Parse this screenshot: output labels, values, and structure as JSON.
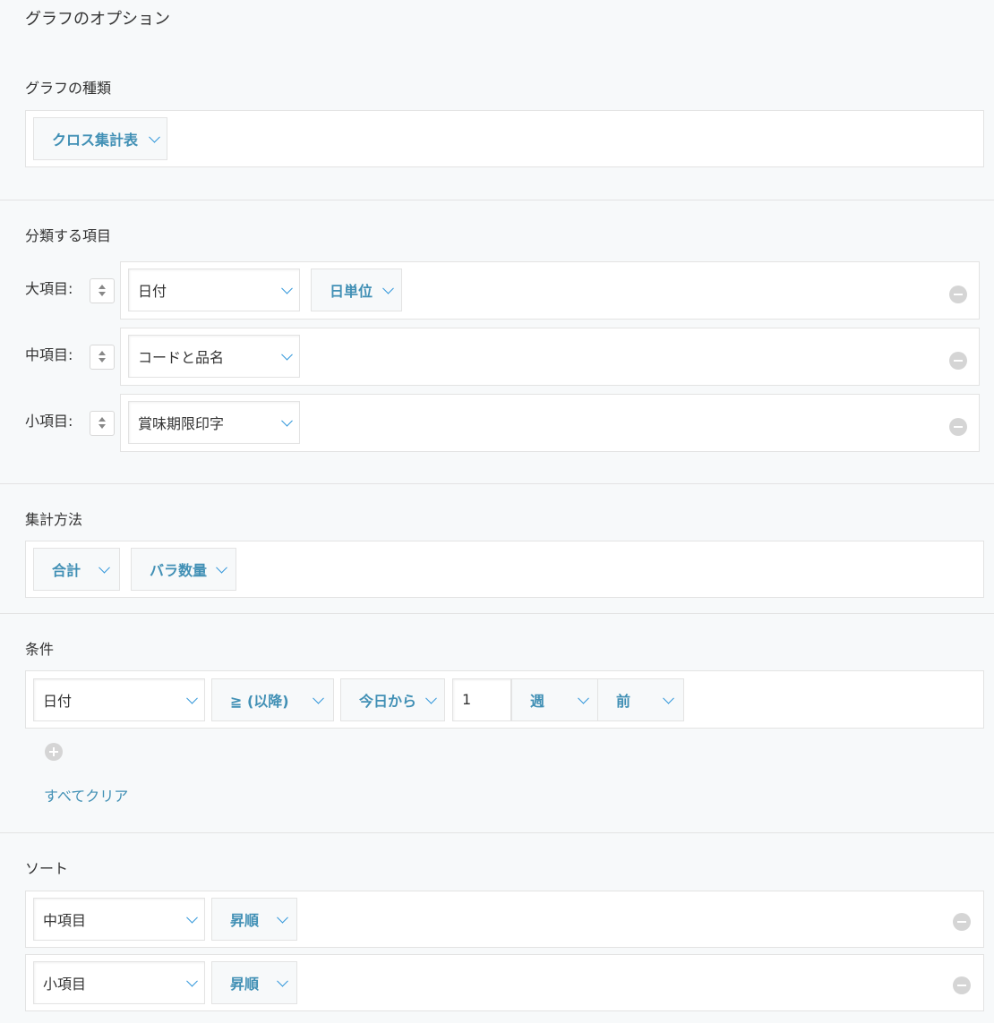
{
  "page_title": "グラフのオプション",
  "sections": {
    "chart_type": {
      "heading": "グラフの種類",
      "value": "クロス集計表"
    },
    "grouping": {
      "heading": "分類する項目",
      "rows": [
        {
          "label": "大項目:",
          "field": "日付",
          "unit": "日単位"
        },
        {
          "label": "中項目:",
          "field": "コードと品名"
        },
        {
          "label": "小項目:",
          "field": "賞味期限印字"
        }
      ]
    },
    "aggregation": {
      "heading": "集計方法",
      "function": "合計",
      "field": "バラ数量"
    },
    "conditions": {
      "heading": "条件",
      "row": {
        "field": "日付",
        "operator": "≧ (以降)",
        "base": "今日から",
        "amount": "1",
        "period": "週",
        "direction": "前"
      },
      "clear_all": "すべてクリア"
    },
    "sort": {
      "heading": "ソート",
      "rows": [
        {
          "field": "中項目",
          "order": "昇順"
        },
        {
          "field": "小項目",
          "order": "昇順"
        }
      ]
    }
  },
  "colors": {
    "accent": "#4190b5",
    "background": "#f7f9fa",
    "border": "#e3e3e3",
    "icon_gray": "#d5d5d5"
  },
  "icons": {
    "dropdown": "chevron-down-icon",
    "stepper": "up-down-stepper-icon",
    "remove": "minus-circle-icon",
    "add": "plus-circle-icon"
  }
}
